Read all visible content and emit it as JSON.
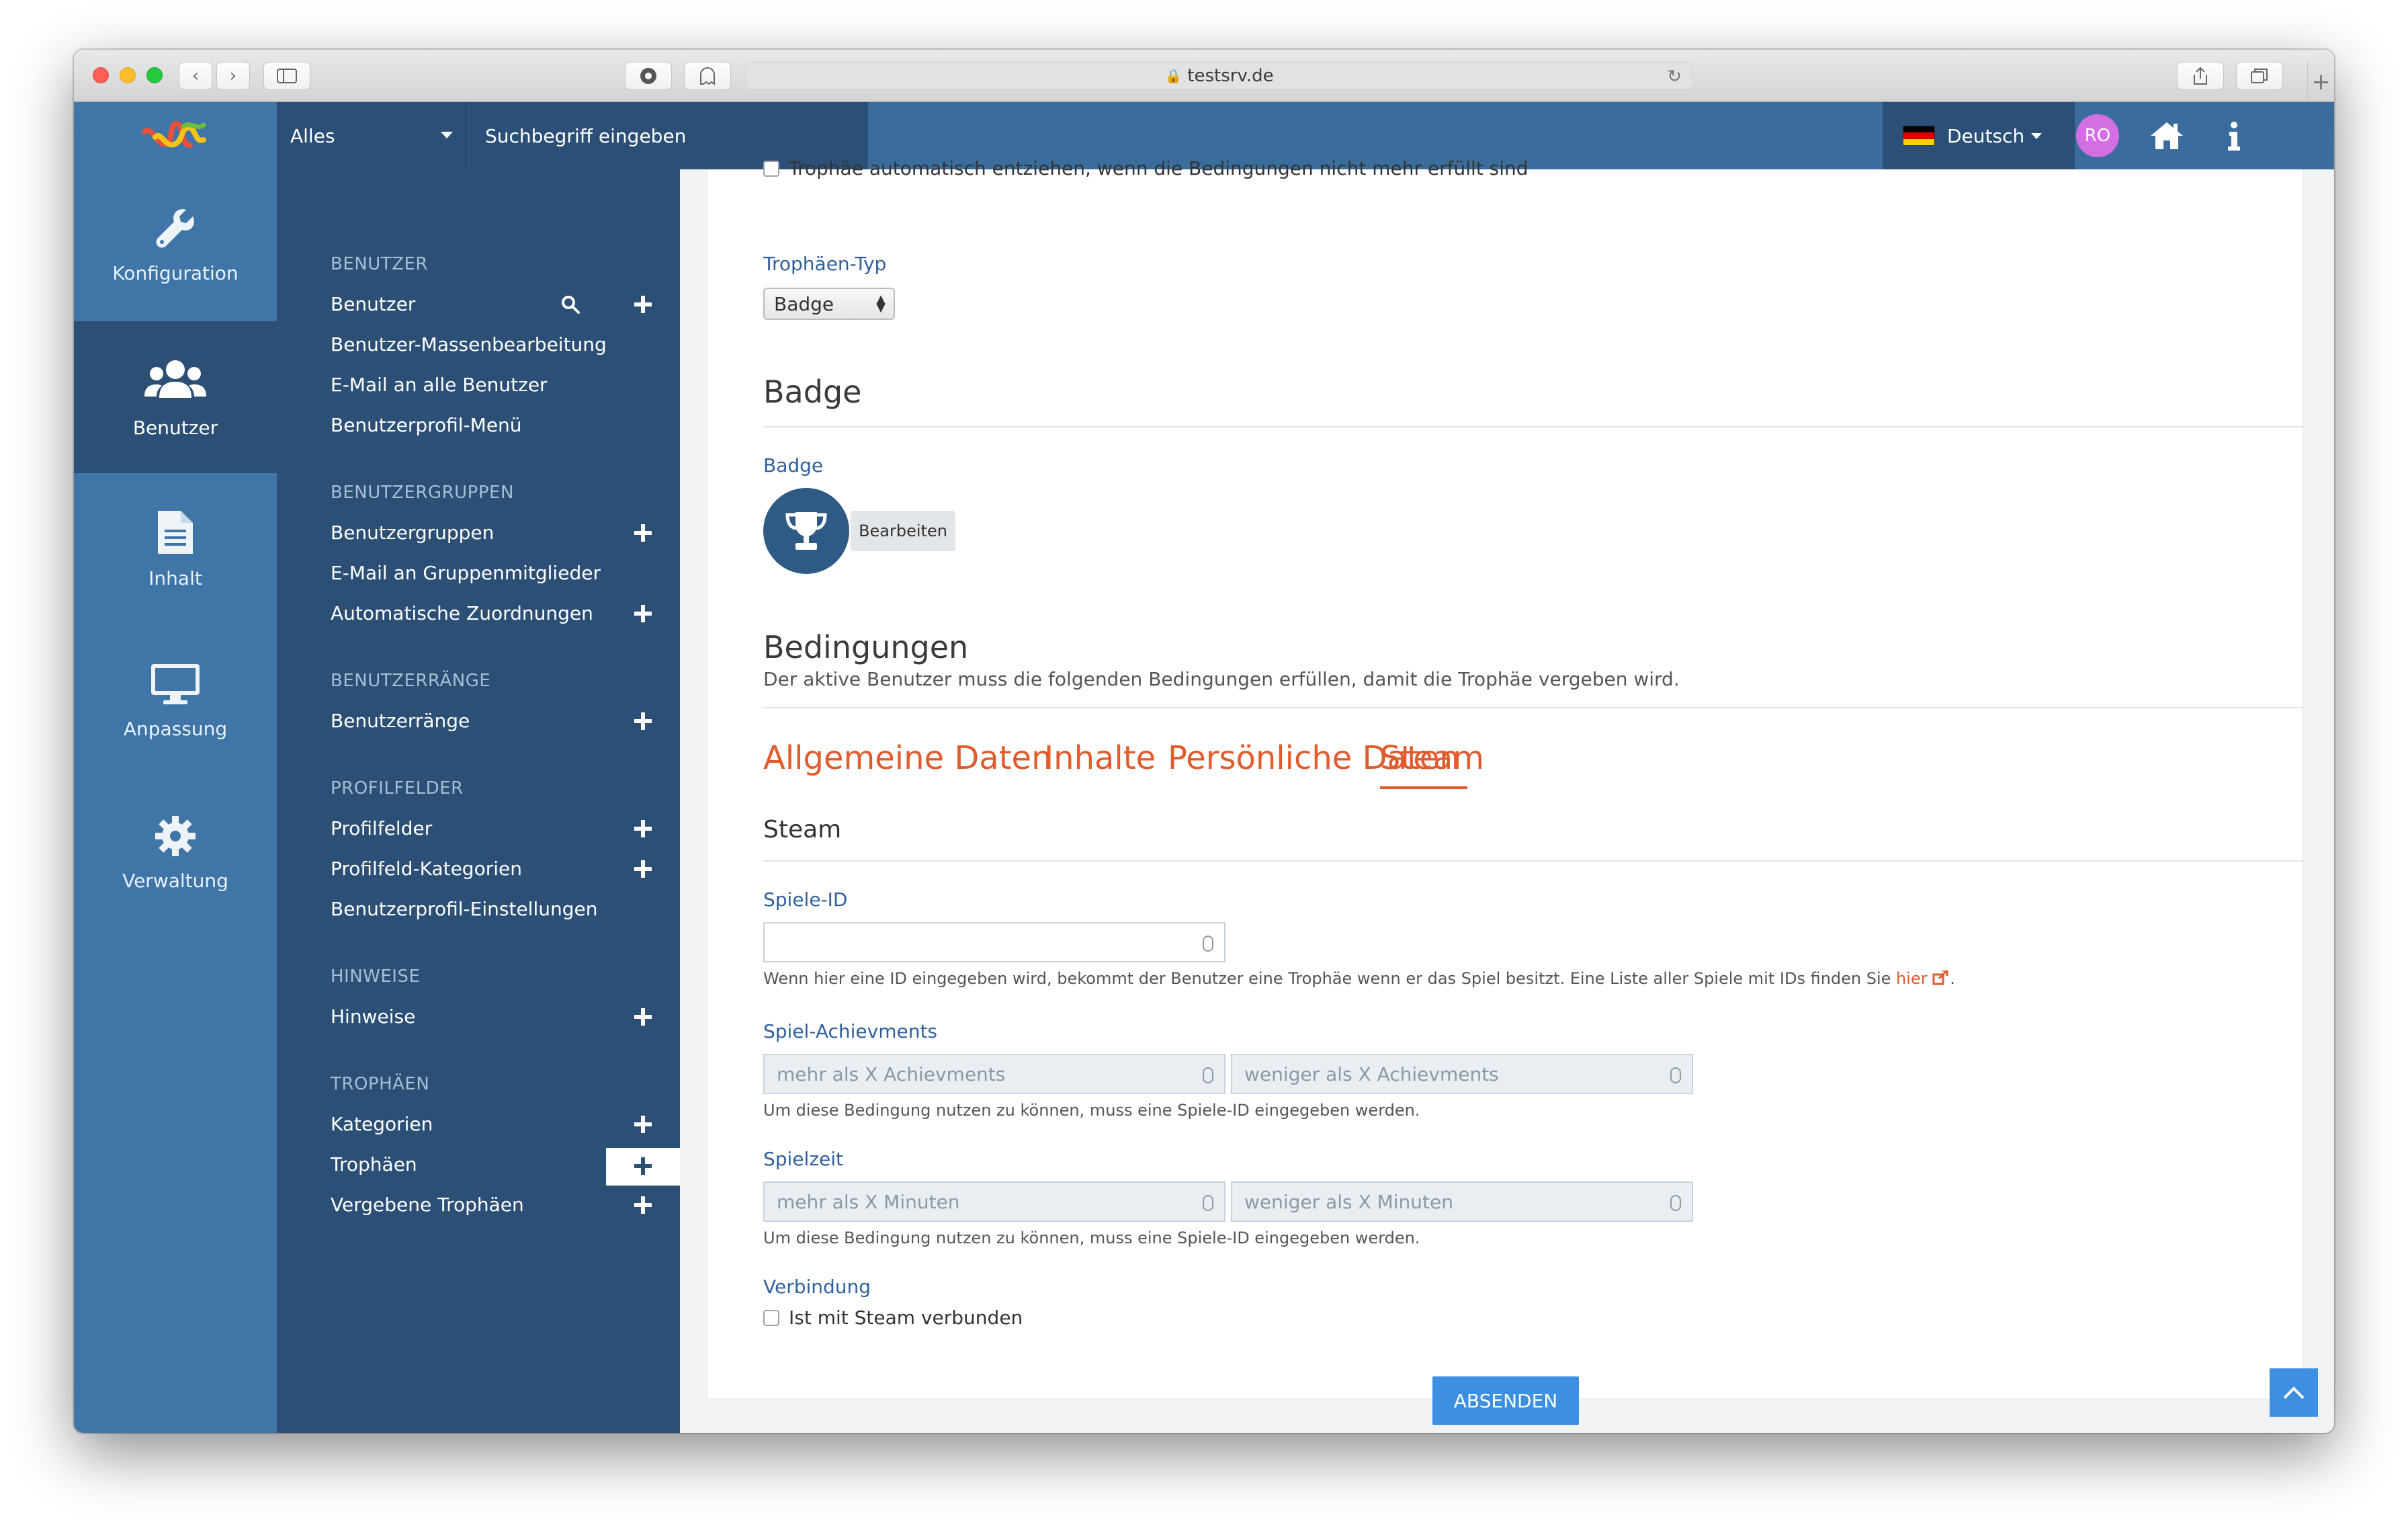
{
  "browser": {
    "url": "testsrv.de"
  },
  "header": {
    "search_category": "Alles",
    "search_placeholder": "Suchbegriff eingeben",
    "language": "Deutsch",
    "avatar_initials": "RO"
  },
  "iconbar": {
    "items": [
      {
        "label": "Konfiguration",
        "icon": "wrench-icon"
      },
      {
        "label": "Benutzer",
        "icon": "users-icon"
      },
      {
        "label": "Inhalt",
        "icon": "document-icon"
      },
      {
        "label": "Anpassung",
        "icon": "monitor-icon"
      },
      {
        "label": "Verwaltung",
        "icon": "gear-icon"
      }
    ]
  },
  "submenu": {
    "benutzer_head": "BENUTZER",
    "benutzer": "Benutzer",
    "massen": "Benutzer-Massenbearbeitung",
    "email_alle": "E-Mail an alle Benutzer",
    "profilmenu": "Benutzerprofil-Menü",
    "gruppen_head": "BENUTZERGRUPPEN",
    "gruppen": "Benutzergruppen",
    "email_gruppen": "E-Mail an Gruppenmitglieder",
    "auto_zuord": "Automatische Zuordnungen",
    "raenge_head": "BENUTZERRÄNGE",
    "raenge": "Benutzerränge",
    "profilfelder_head": "PROFILFELDER",
    "profilfelder": "Profilfelder",
    "profilfeld_kat": "Profilfeld-Kategorien",
    "profil_einst": "Benutzerprofil-Einstellungen",
    "hinweise_head": "HINWEISE",
    "hinweise": "Hinweise",
    "trophaeen_head": "TROPHÄEN",
    "kategorien": "Kategorien",
    "trophaeen": "Trophäen",
    "vergebene": "Vergebene Trophäen"
  },
  "content": {
    "cut_text": "Trophäe automatisch entziehen, wenn die Bedingungen nicht mehr erfüllt sind",
    "typ_label": "Trophäen-Typ",
    "typ_value": "Badge",
    "badge_title": "Badge",
    "badge_label": "Badge",
    "edit_button": "Bearbeiten",
    "bed_title": "Bedingungen",
    "bed_desc": "Der aktive Benutzer muss die folgenden Bedingungen erfüllen, damit die Trophäe vergeben wird.",
    "tabs": [
      "Allgemeine Daten",
      "Inhalte",
      "Persönliche Daten",
      "Steam"
    ],
    "steam_title": "Steam",
    "spiele_id_label": "Spiele-ID",
    "spiele_id_help_pre": "Wenn hier eine ID eingegeben wird, bekommt der Benutzer eine Trophäe wenn er das Spiel besitzt. Eine Liste aller Spiele mit IDs finden Sie ",
    "spiele_id_help_link": "hier",
    "spiele_id_help_post": ".",
    "ach_label": "Spiel-Achievments",
    "ach_more": "mehr als X Achievments",
    "ach_less": "weniger als X Achievments",
    "ach_help": "Um diese Bedingung nutzen zu können, muss eine Spiele-ID eingegeben werden.",
    "zeit_label": "Spielzeit",
    "zeit_more": "mehr als X Minuten",
    "zeit_less": "weniger als X Minuten",
    "zeit_help": "Um diese Bedingung nutzen zu können, muss eine Spiele-ID eingegeben werden.",
    "verb_label": "Verbindung",
    "verb_checkbox": "Ist mit Steam verbunden",
    "submit": "ABSENDEN"
  },
  "colors": {
    "accent": "#e25b2c",
    "primary": "#3d8fe2",
    "sidebar": "#3f75a7",
    "submenu": "#2c4f75"
  }
}
